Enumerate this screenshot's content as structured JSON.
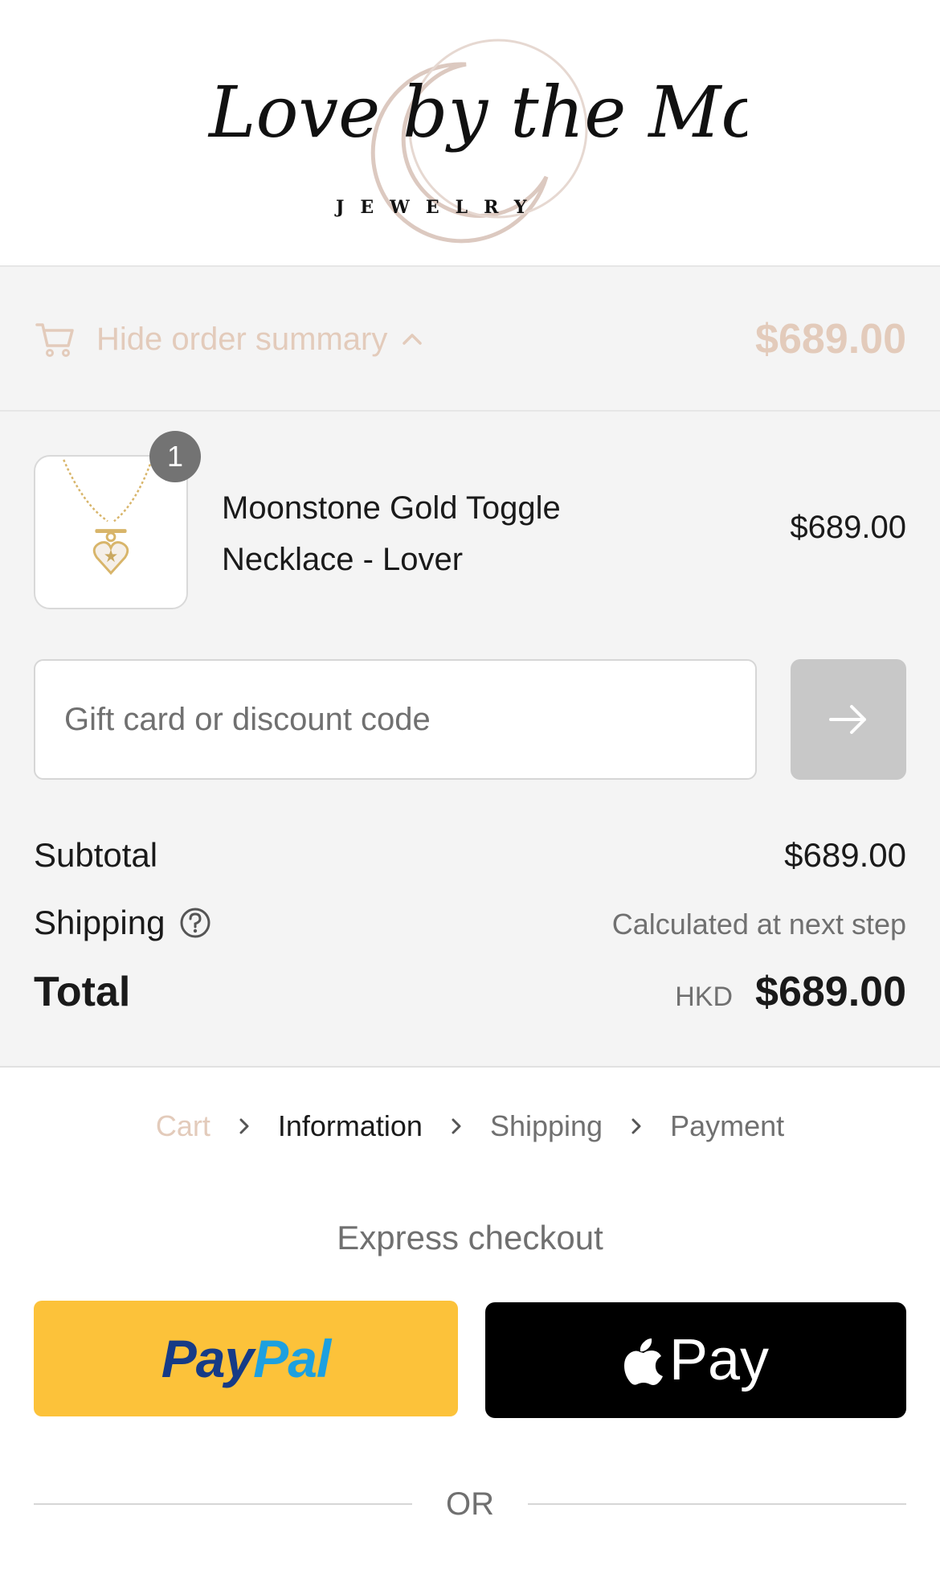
{
  "header": {
    "logo_script": "Love by the Moon.",
    "logo_sub": "JEWELRY"
  },
  "summary_toggle": {
    "label": "Hide order summary",
    "total": "$689.00",
    "icon": "cart-icon",
    "chevron": "chevron-up-icon"
  },
  "order": {
    "items": [
      {
        "name": "Moonstone Gold Toggle Necklace - Lover",
        "price": "$689.00",
        "quantity": "1"
      }
    ]
  },
  "discount": {
    "placeholder": "Gift card or discount code",
    "value": "",
    "apply_icon": "arrow-right-icon"
  },
  "totals": {
    "subtotal_label": "Subtotal",
    "subtotal_value": "$689.00",
    "shipping_label": "Shipping",
    "shipping_value": "Calculated at next step",
    "total_label": "Total",
    "currency": "HKD",
    "total_value": "$689.00"
  },
  "breadcrumb": {
    "items": [
      "Cart",
      "Information",
      "Shipping",
      "Payment"
    ],
    "active": "Information"
  },
  "express": {
    "title": "Express checkout",
    "paypal_part1": "Pay",
    "paypal_part2": "Pal",
    "applepay_label": "Pay",
    "or_label": "OR"
  },
  "colors": {
    "accent": "#e3cbbb",
    "paypal_yellow": "#fcc23a",
    "paypal_dark": "#163b86",
    "paypal_light": "#1da0e0",
    "summary_bg": "#f4f4f4"
  }
}
